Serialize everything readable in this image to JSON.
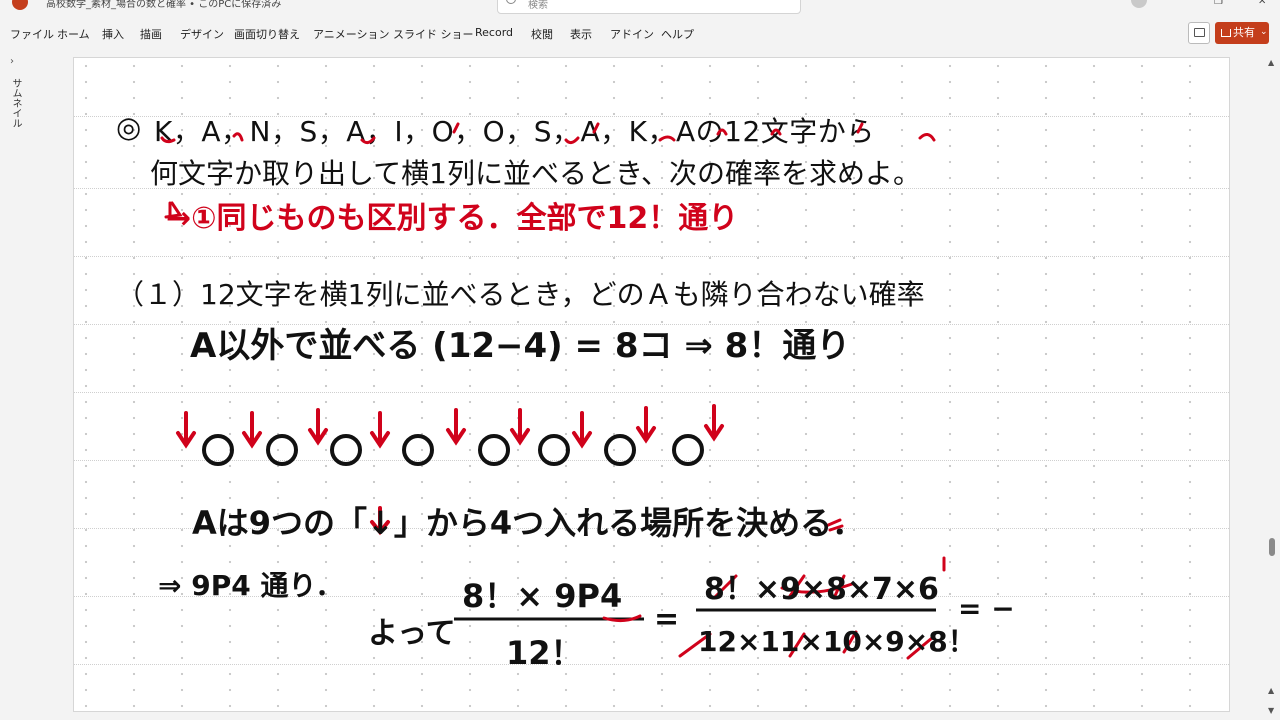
{
  "window": {
    "title": "高校数学_素材_場合の数と確率 • このPCに保存済み",
    "search_placeholder": "検索"
  },
  "menu": [
    "ファイル",
    "ホーム",
    "挿入",
    "描画",
    "デザイン",
    "画面切り替え",
    "アニメーション",
    "スライド ショー",
    "Record",
    "校閲",
    "表示",
    "アドイン",
    "ヘルプ"
  ],
  "share_label": "共有",
  "thumbnail_pane_label": "サムネイル",
  "slide": {
    "problem_marker": "◎",
    "problem_line1": "K，A，N，S，A，I，O，O，S，A，K，Aの12文字から",
    "problem_line2": "何文字か取り出して横1列に並べるとき、次の確率を求めよ。",
    "q1": "（１）12文字を横1列に並べるとき，どのＡも隣り合わない確率"
  },
  "handwriting": {
    "note_red_1": "→①同じものも区別する．全部で12！通り",
    "note_black_1": "A以外で並べる (12−4) = 8コ ⇒ 8！通り",
    "note_black_2": "Aは9つの「↓」から4つ入れる場所を決める．",
    "note_black_3": "⇒ 9P4 通り．",
    "note_black_4": "よって",
    "frac1_num": "8！× 9P4",
    "frac1_den": "12！",
    "frac2_num": "8！×9×8×7×6",
    "frac2_den": "12×11×10×9×8！",
    "tail": "= −"
  },
  "colors": {
    "accent": "#c43e1c",
    "ink_black": "#111111",
    "ink_red": "#d0021b"
  }
}
